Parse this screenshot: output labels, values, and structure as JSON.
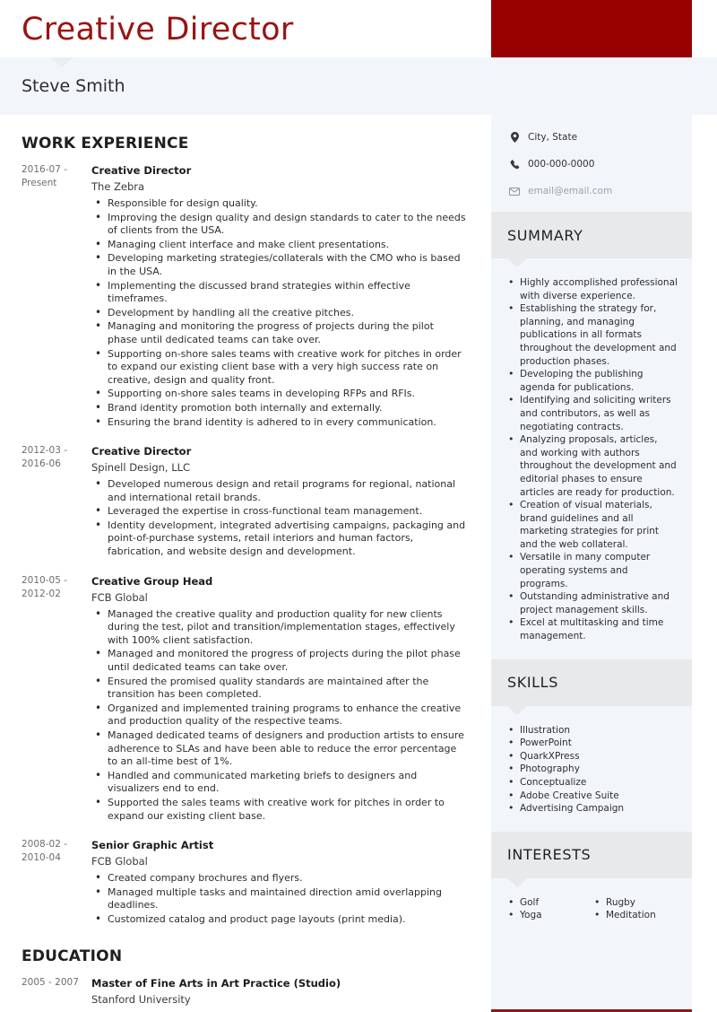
{
  "header": {
    "title": "Creative Director",
    "name": "Steve Smith",
    "accent_color": "#990000",
    "title_color": "#9b1212",
    "band_color": "#f2f6fa"
  },
  "main": {
    "work_section_title": "WORK EXPERIENCE",
    "education_section_title": "EDUCATION",
    "experience": [
      {
        "dates": "2016-07 - Present",
        "role": "Creative Director",
        "org": "The Zebra",
        "bullets": [
          "Responsible for design quality.",
          "Improving the design quality and design standards to cater to the needs of clients from the USA.",
          "Managing client interface and make client presentations.",
          "Developing marketing strategies/collaterals with the CMO who is based in the USA.",
          "Implementing the discussed brand strategies within effective timeframes.",
          "Development by handling all the creative pitches.",
          "Managing and monitoring the progress of projects during the pilot phase until dedicated teams can take over.",
          "Supporting on-shore sales teams with creative work for pitches in order to expand our existing client base with a very high success rate on creative, design and quality front.",
          "Supporting on-shore sales teams in developing RFPs and RFIs.",
          "Brand identity promotion both internally and externally.",
          "Ensuring the brand identity is adhered to in every communication."
        ]
      },
      {
        "dates": "2012-03 - 2016-06",
        "role": "Creative Director",
        "org": "Spinell Design, LLC",
        "bullets": [
          "Developed numerous design and retail programs for regional, national and international retail brands.",
          "Leveraged the expertise in cross-functional team management.",
          "Identity development, integrated advertising campaigns, packaging and point-of-purchase systems, retail interiors and human factors, fabrication, and website design and development."
        ]
      },
      {
        "dates": "2010-05 - 2012-02",
        "role": "Creative Group Head",
        "org": "FCB Global",
        "bullets": [
          "Managed the creative quality and production quality for new clients during the test, pilot and transition/implementation stages, effectively with 100% client satisfaction.",
          "Managed and monitored the progress of projects during the pilot phase until dedicated teams can take over.",
          "Ensured the promised quality standards are maintained after the transition has been completed.",
          "Organized and implemented training programs to enhance the creative and production quality of the respective teams.",
          "Managed dedicated teams of designers and production artists to ensure adherence to SLAs and have been able to reduce the error percentage to an all-time best of 1%.",
          "Handled and communicated marketing briefs to designers and visualizers end to end.",
          "Supported the sales teams with creative work for pitches in order to expand our existing client base."
        ]
      },
      {
        "dates": "2008-02 - 2010-04",
        "role": "Senior Graphic Artist",
        "org": "FCB Global",
        "bullets": [
          "Created company brochures and flyers.",
          "Managed multiple tasks and maintained direction amid overlapping deadlines.",
          "Customized catalog and product page layouts (print media)."
        ]
      }
    ],
    "education": [
      {
        "dates": "2005 - 2007",
        "degree": "Master of Fine Arts in Art Practice (Studio)",
        "school": "Stanford University"
      }
    ]
  },
  "sidebar": {
    "contact": [
      {
        "icon": "location-pin-icon",
        "text": "City, State",
        "muted": false
      },
      {
        "icon": "phone-icon",
        "text": "000-000-0000",
        "muted": false
      },
      {
        "icon": "envelope-icon",
        "text": "email@email.com",
        "muted": true
      }
    ],
    "summary": {
      "title": "SUMMARY",
      "items": [
        "Highly accomplished professional with diverse experience.",
        "Establishing the strategy for, planning, and managing publications in all formats throughout the development and production phases.",
        "Developing the publishing agenda for publications.",
        "Identifying and soliciting writers and contributors, as well as negotiating contracts.",
        "Analyzing proposals, articles, and working with authors throughout the development and editorial phases to ensure articles are ready for production.",
        "Creation of visual materials, brand guidelines and all marketing strategies for print and the web collateral.",
        "Versatile in many computer operating systems and programs.",
        "Outstanding administrative and project management skills.",
        "Excel at multitasking and time management."
      ]
    },
    "skills": {
      "title": "SKILLS",
      "items": [
        "Illustration",
        "PowerPoint",
        "QuarkXPress",
        "Photography",
        "Conceptualize",
        "Adobe Creative Suite",
        "Advertising Campaign"
      ]
    },
    "interests": {
      "title": "INTERESTS",
      "column_left": [
        "Golf",
        "Yoga"
      ],
      "column_right": [
        "Rugby",
        "Meditation"
      ]
    }
  }
}
